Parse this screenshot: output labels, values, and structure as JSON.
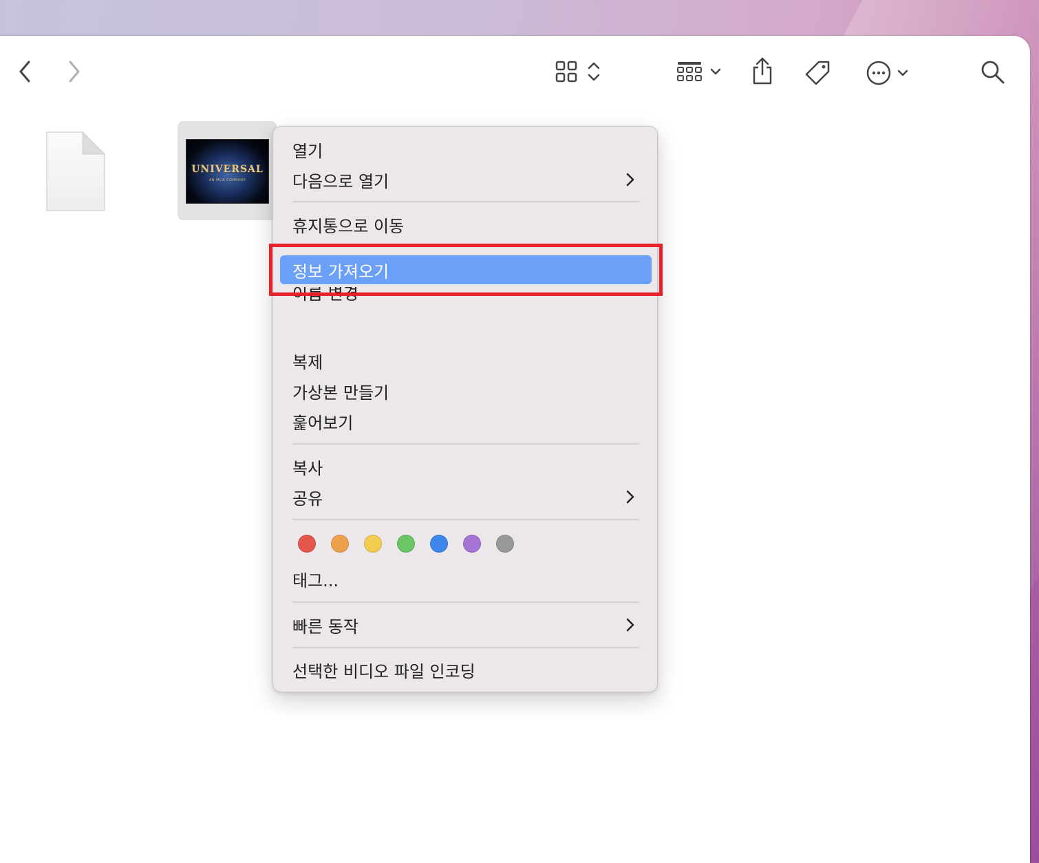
{
  "toolbar": {
    "back": "chevron-left-icon",
    "forward": "chevron-right-icon",
    "view_mode": "icon-grid-icon",
    "group": "group-grid-icon",
    "share": "share-icon",
    "tag": "tag-icon",
    "more": "ellipsis-circle-icon",
    "search": "search-icon"
  },
  "files": [
    {
      "icon": "blank-document-icon",
      "selected": false
    },
    {
      "icon": "video-thumbnail",
      "thumb_title": "UNIVERSAL",
      "thumb_subtitle": "AN MCA COMPANY",
      "selected": true
    }
  ],
  "context_menu": {
    "open": "열기",
    "open_with": "다음으로 열기",
    "move_to_trash": "휴지통으로 이동",
    "get_info": "정보 가져오기",
    "rename": "이름 변경",
    "duplicate": "복제",
    "make_alias": "가상본 만들기",
    "quick_look": "훑어보기",
    "copy": "복사",
    "share": "공유",
    "tag_colors": [
      "#e5574d",
      "#eda14a",
      "#f2cd4f",
      "#6cc564",
      "#3d86ec",
      "#a674d4",
      "#98979a"
    ],
    "tags": "태그...",
    "quick_actions": "빠른 동작",
    "encode_video": "선택한 비디오 파일 인코딩",
    "highlighted": "get_info"
  },
  "annotation": {
    "color": "#e8212b"
  }
}
